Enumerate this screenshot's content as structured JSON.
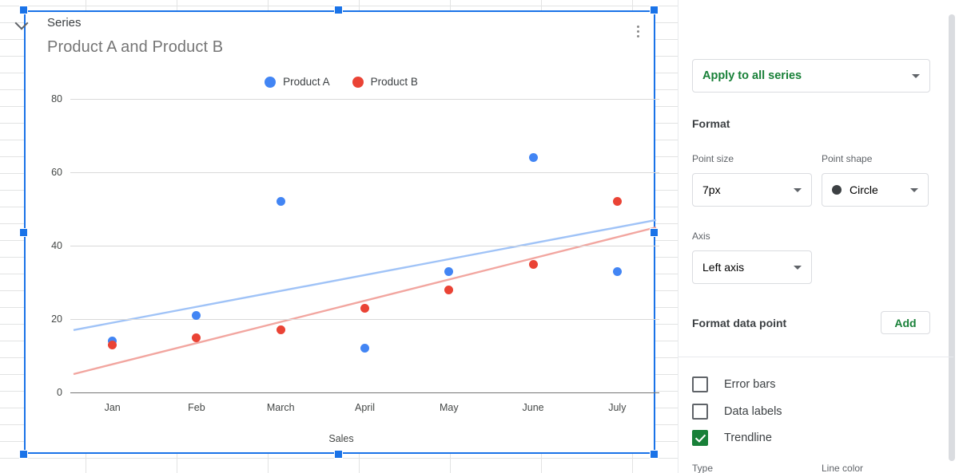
{
  "chart_data": {
    "type": "scatter",
    "title": "Product A and Product B",
    "xlabel": "Sales",
    "ylabel": "",
    "categories": [
      "Jan",
      "Feb",
      "March",
      "April",
      "May",
      "June",
      "July"
    ],
    "yticks": [
      0,
      20,
      40,
      60,
      80
    ],
    "ylim": [
      0,
      80
    ],
    "grid": true,
    "legend_position": "top-center",
    "series": [
      {
        "name": "Product A",
        "color": "#4285f4",
        "values": [
          14,
          21,
          52,
          12,
          33,
          64,
          33
        ],
        "trendline": {
          "visible": true,
          "color": "#a0c3f7",
          "start": 17,
          "end": 47
        }
      },
      {
        "name": "Product B",
        "color": "#ea4335",
        "values": [
          13,
          15,
          17,
          23,
          28,
          35,
          52
        ],
        "trendline": {
          "visible": true,
          "color": "#f2a6a0",
          "start": 5,
          "end": 45
        }
      }
    ]
  },
  "chart_menu": {
    "icon": "kebab-menu-icon"
  },
  "panel": {
    "section": {
      "title": "Series",
      "chevron_icon": "chevron-down-icon"
    },
    "apply_dropdown": {
      "value": "Apply to all series",
      "caret_icon": "chevron-down-icon"
    },
    "format_heading": "Format",
    "point_size": {
      "label": "Point size",
      "value": "7px",
      "caret_icon": "chevron-down-icon"
    },
    "point_shape": {
      "label": "Point shape",
      "value": "Circle",
      "shape_icon": "filled-circle-icon",
      "caret_icon": "chevron-down-icon"
    },
    "axis": {
      "label": "Axis",
      "value": "Left axis",
      "caret_icon": "chevron-down-icon"
    },
    "format_data_point": {
      "label": "Format data point",
      "add_label": "Add"
    },
    "checkboxes": [
      {
        "label": "Error bars",
        "checked": false
      },
      {
        "label": "Data labels",
        "checked": false
      },
      {
        "label": "Trendline",
        "checked": true
      }
    ],
    "trendline_options": {
      "type_label": "Type",
      "line_color_label": "Line color"
    }
  },
  "colors": {
    "accent_blue": "#1a73e8",
    "green": "#188038",
    "series_a": "#4285f4",
    "series_b": "#ea4335"
  }
}
